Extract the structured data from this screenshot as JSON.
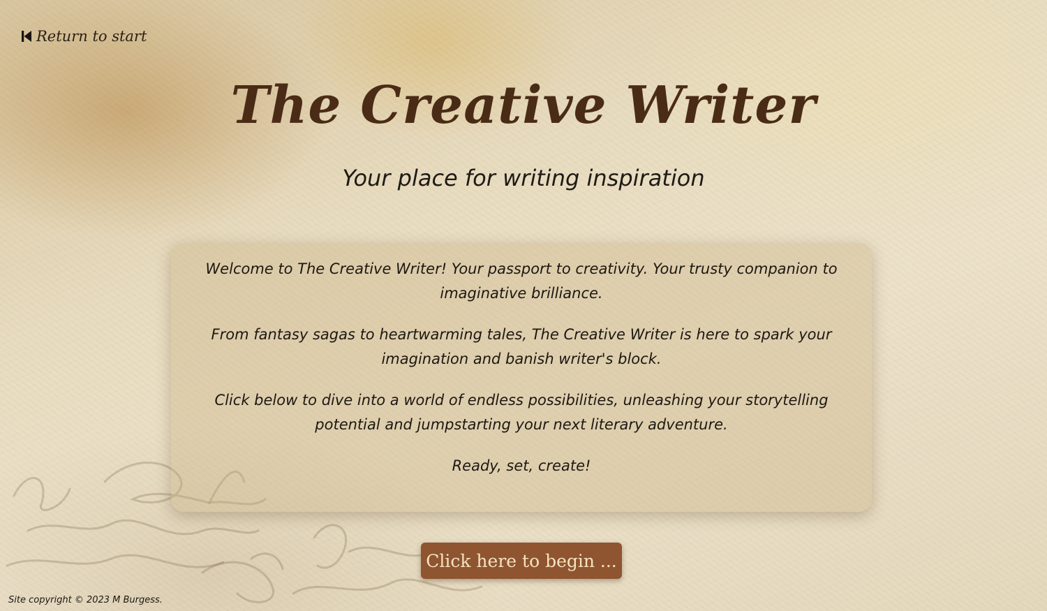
{
  "nav": {
    "return_label": "Return to start",
    "return_icon": "skip-back-icon"
  },
  "header": {
    "title": "The Creative Writer",
    "subtitle": "Your place for writing inspiration"
  },
  "intro": {
    "paragraphs": [
      "Welcome to The Creative Writer! Your passport to creativity. Your trusty companion to imaginative brilliance.",
      "From fantasy sagas to heartwarming tales, The Creative Writer is here to spark your imagination and banish writer's block.",
      "Click below to dive into a world of endless possibilities, unleashing your storytelling potential and jumpstarting your next literary adventure.",
      "Ready, set, create!"
    ]
  },
  "cta": {
    "begin_label": "Click here to begin ..."
  },
  "footer": {
    "copyright": "Site copyright © 2023 M Burgess."
  },
  "colors": {
    "title": "#4a2c16",
    "button_bg": "#8e5530",
    "button_text": "#f6e3c2",
    "text": "#1d1812"
  }
}
